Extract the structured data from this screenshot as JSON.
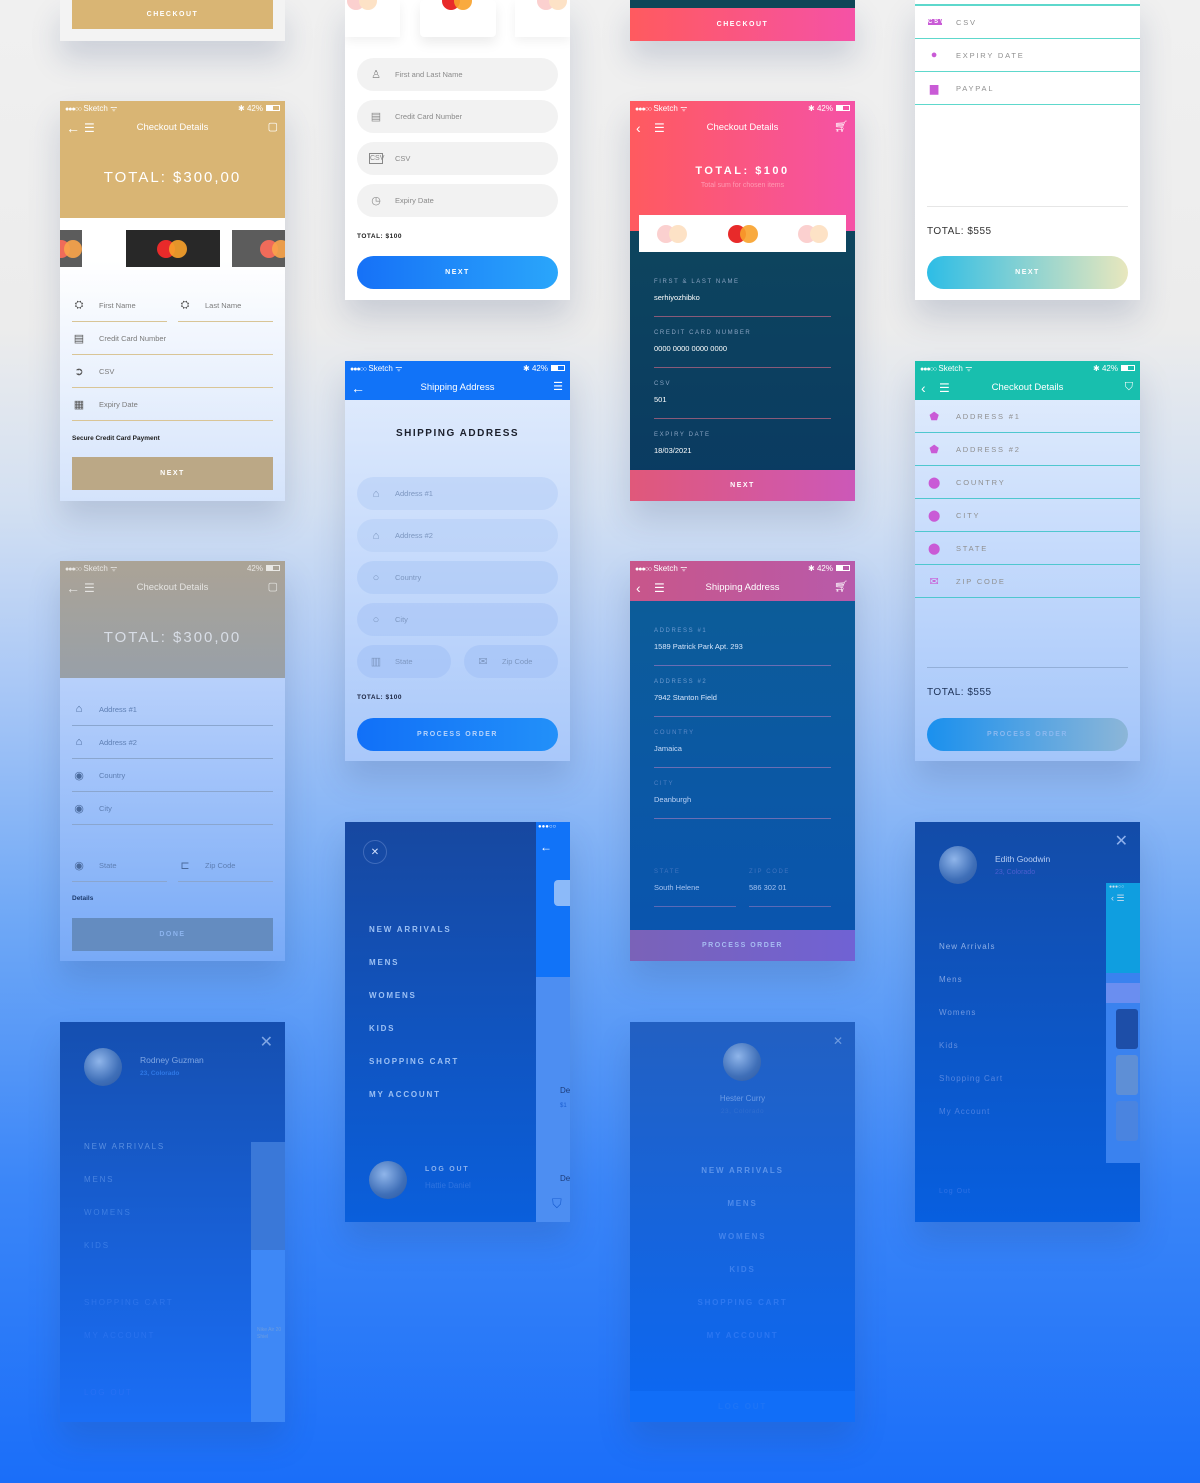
{
  "status_bar": {
    "carrier": "Sketch",
    "signal": "●●●○○",
    "battery": "42%",
    "bluetooth": "✱"
  },
  "screen_gold_top": {
    "button": "CHECKOUT"
  },
  "screen_gold_payment": {
    "nav_title": "Checkout Details",
    "total": "TOTAL: $300,00",
    "fields": {
      "first_name": "First Name",
      "last_name": "Last Name",
      "card": "Credit Card Number",
      "csv": "CSV",
      "expiry": "Expiry Date"
    },
    "note": "Secure Credit Card Payment",
    "button": "NEXT"
  },
  "screen_gold_address": {
    "nav_title": "Checkout Details",
    "total": "TOTAL: $300,00",
    "fields": {
      "address1": "Address #1",
      "address2": "Address #2",
      "country": "Country",
      "city": "City",
      "state": "State",
      "zip": "Zip Code"
    },
    "note": "Details",
    "button": "DONE"
  },
  "screen_white_payment": {
    "fields": {
      "name": "First and Last Name",
      "card": "Credit Card Number",
      "csv": "CSV",
      "expiry": "Expiry Date"
    },
    "total": "TOTAL: $100",
    "button": "NEXT"
  },
  "screen_blue_shipping": {
    "nav_title": "Shipping Address",
    "heading": "SHIPPING ADDRESS",
    "fields": {
      "address1": "Address #1",
      "address2": "Address #2",
      "country": "Country",
      "city": "City",
      "state": "State",
      "zip": "Zip Code"
    },
    "total": "TOTAL: $100",
    "button": "PROCESS ORDER"
  },
  "screen_menu_hattie": {
    "items": [
      "NEW ARRIVALS",
      "MENS",
      "WOMENS",
      "KIDS",
      "SHOPPING CART",
      "MY ACCOUNT"
    ],
    "logout": "LOG OUT",
    "user": "Hattie Daniel",
    "peek": {
      "line1": "De",
      "line2": "$1",
      "line3": "De"
    }
  },
  "screen_pink_top": {
    "button": "CHECKOUT"
  },
  "screen_pink_payment": {
    "nav_title": "Checkout Details",
    "total": "TOTAL: $100",
    "subtitle": "Total sum for chosen items",
    "fields": [
      {
        "label": "FIRST & LAST NAME",
        "value": "serhiyozhibko"
      },
      {
        "label": "CREDIT CARD NUMBER",
        "value": "0000 0000 0000 0000"
      },
      {
        "label": "CSV",
        "value": "501"
      },
      {
        "label": "EXPIRY DATE",
        "value": "18/03/2021"
      }
    ],
    "button": "NEXT"
  },
  "screen_pink_shipping": {
    "nav_title": "Shipping Address",
    "fields": [
      {
        "label": "ADDRESS #1",
        "value": "1589 Patrick Park Apt. 293"
      },
      {
        "label": "ADDRESS #2",
        "value": "7942 Stanton Field"
      },
      {
        "label": "COUNTRY",
        "value": "Jamaica"
      },
      {
        "label": "CITY",
        "value": "Deanburgh"
      }
    ],
    "state": {
      "label": "STATE",
      "value": "South Helene"
    },
    "zip": {
      "label": "ZIP CODE",
      "value": "586 302 01"
    },
    "button": "PROCESS ORDER"
  },
  "screen_menu_hester": {
    "name": "Hester Curry",
    "location": "23, Colorado",
    "items": [
      "NEW ARRIVALS",
      "MENS",
      "WOMENS",
      "KIDS",
      "SHOPPING CART",
      "MY ACCOUNT"
    ],
    "logout": "LOG OUT"
  },
  "screen_teal_payment": {
    "rows": [
      "CSV",
      "EXPIRY DATE",
      "PAYPAL"
    ],
    "total": "TOTAL: $555",
    "button": "NEXT"
  },
  "screen_teal_address": {
    "nav_title": "Checkout Details",
    "rows": [
      "ADDRESS #1",
      "ADDRESS #2",
      "COUNTRY",
      "CITY",
      "STATE",
      "ZIP CODE"
    ],
    "total": "TOTAL: $555",
    "button": "PROCESS ORDER"
  },
  "screen_menu_edith": {
    "name": "Edith Goodwin",
    "location": "23, Colorado",
    "items": [
      "New Arrivals",
      "Mens",
      "Womens",
      "Kids",
      "Shopping Cart",
      "My Account"
    ],
    "logout": "Log Out"
  },
  "screen_menu_rodney": {
    "name": "Rodney Guzman",
    "location": "23, Colorado",
    "items": [
      "NEW ARRIVALS",
      "MENS",
      "WOMENS",
      "KIDS",
      "SHOPPING CART",
      "MY ACCOUNT"
    ],
    "logout": "LOG OUT",
    "peek": "Nike Air 20 Shiel"
  },
  "colors": {
    "gold": "#d9b574",
    "pink": "#ff5a78",
    "magenta": "#f552a6",
    "teal": "#18bfae",
    "blue": "#1173f8",
    "purple": "#c95bd6"
  }
}
